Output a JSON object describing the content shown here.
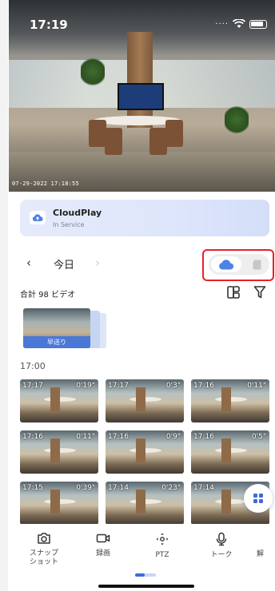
{
  "status_bar": {
    "time": "17:19"
  },
  "live_video": {
    "timestamp": "07-29-2022 17:18:55"
  },
  "cloud_card": {
    "title": "CloudPlay",
    "subtitle": "In Service"
  },
  "date_nav": {
    "prev_glyph": "‹",
    "date": "今日",
    "next_glyph": "›"
  },
  "storage_toggle": {
    "selected": "cloud",
    "options": [
      "cloud",
      "sd-card"
    ]
  },
  "list_header": {
    "count_text": "合計 98 ビデオ"
  },
  "fast_forward": {
    "label": "早送り"
  },
  "group": {
    "hour": "17:00"
  },
  "clips": [
    {
      "time": "17:17",
      "duration": "0'19\""
    },
    {
      "time": "17:17",
      "duration": "0'3\""
    },
    {
      "time": "17:16",
      "duration": "0'11\""
    },
    {
      "time": "17:16",
      "duration": "0'11\""
    },
    {
      "time": "17:16",
      "duration": "0'9\""
    },
    {
      "time": "17:16",
      "duration": "0'5\""
    },
    {
      "time": "17:15",
      "duration": "0'39\""
    },
    {
      "time": "17:14",
      "duration": "0'23\""
    },
    {
      "time": "17:14",
      "duration": ""
    }
  ],
  "toolbar": {
    "snapshot": "スナップ\nショット",
    "record": "録画",
    "ptz": "PTZ",
    "talk": "トーク",
    "more": "解"
  },
  "colors": {
    "accent": "#3d6bd6",
    "highlight": "#e8202a"
  }
}
